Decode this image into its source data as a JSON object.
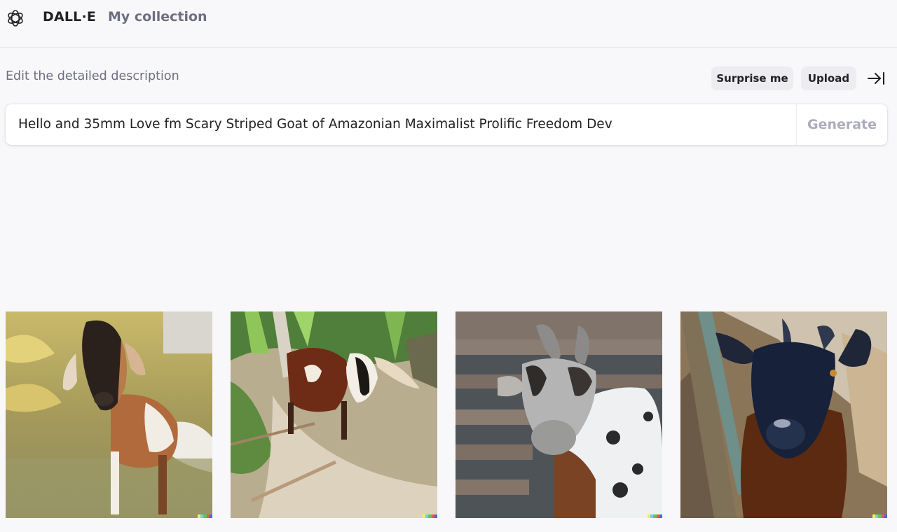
{
  "header": {
    "brand": "DALL·E",
    "nav_collection": "My collection"
  },
  "editor": {
    "label": "Edit the detailed description",
    "surprise_label": "Surprise me",
    "upload_label": "Upload",
    "prompt_value": "Hello and 35mm Love fm Scary Striped Goat of Amazonian Maximalist Prolific Freedom Dev",
    "generate_label": "Generate"
  },
  "results": {
    "images": [
      {
        "subject": "goat-image-1"
      },
      {
        "subject": "goat-image-2"
      },
      {
        "subject": "goat-image-3"
      },
      {
        "subject": "goat-image-4"
      }
    ],
    "signature_colors": [
      "#f6f063",
      "#61dcd0",
      "#59c864",
      "#e65a42",
      "#4d64e6"
    ]
  },
  "icons": {
    "logo": "openai-logo-icon",
    "collapse": "collapse-sidebar-icon"
  }
}
